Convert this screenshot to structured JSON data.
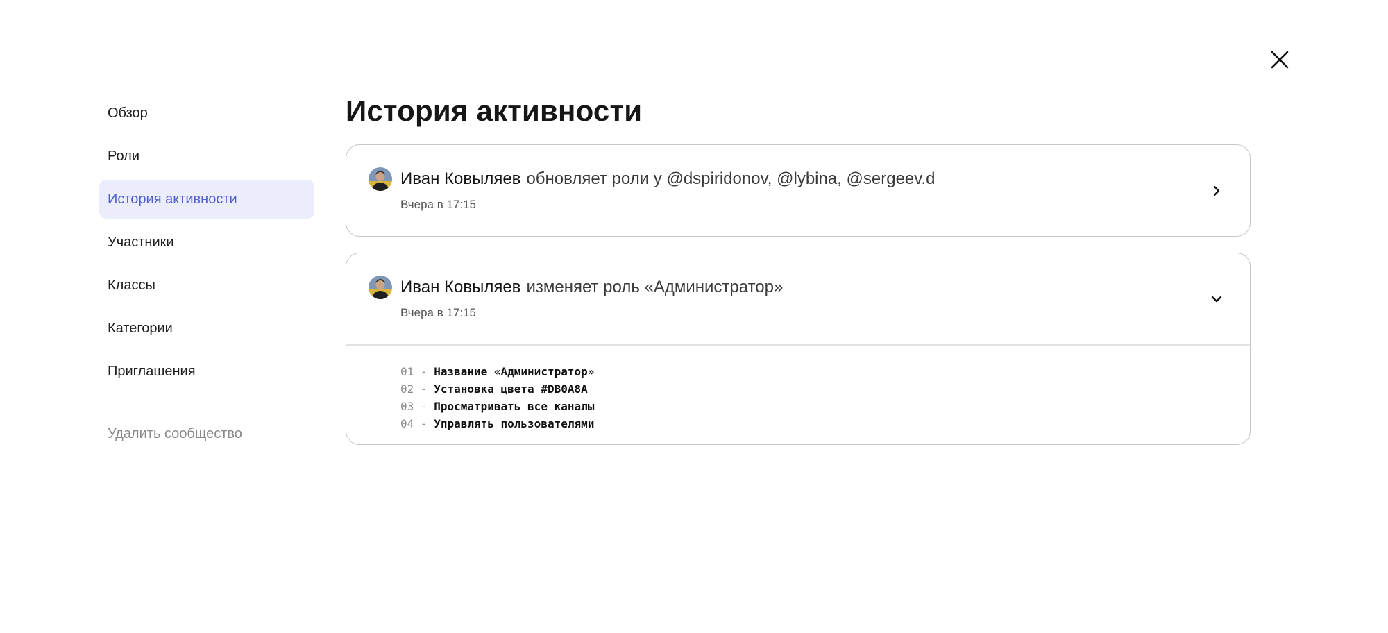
{
  "close": {
    "icon": "close-icon"
  },
  "sidebar": {
    "items": [
      {
        "label": "Обзор",
        "active": false
      },
      {
        "label": "Роли",
        "active": false
      },
      {
        "label": "История активности",
        "active": true
      },
      {
        "label": "Участники",
        "active": false
      },
      {
        "label": "Классы",
        "active": false
      },
      {
        "label": "Категории",
        "active": false
      },
      {
        "label": "Приглашения",
        "active": false
      }
    ],
    "danger_label": "Удалить сообщество"
  },
  "main": {
    "title": "История активности",
    "events": [
      {
        "actor": "Иван Ковыляев",
        "action": "обновляет роли у @dspiridonov, @lybina, @sergeev.d",
        "time": "Вчера в 17:15",
        "expanded": false,
        "toggle_icon": "chevron-right-icon"
      },
      {
        "actor": "Иван Ковыляев",
        "action": "изменяет роль «Администратор»",
        "time": "Вчера в 17:15",
        "expanded": true,
        "toggle_icon": "chevron-down-icon",
        "changes": [
          {
            "num": "01",
            "sep": "-",
            "text": "Название «Администратор»"
          },
          {
            "num": "02",
            "sep": "-",
            "text": "Установка цвета #DB0A8A"
          },
          {
            "num": "03",
            "sep": "-",
            "text": "Просматривать все каналы"
          },
          {
            "num": "04",
            "sep": "-",
            "text": "Управлять пользователями"
          }
        ]
      }
    ]
  },
  "colors": {
    "accent": "#5160cf",
    "active_bg": "#ecedfc",
    "border": "#c6c6c6",
    "muted": "#8a8a8a"
  }
}
